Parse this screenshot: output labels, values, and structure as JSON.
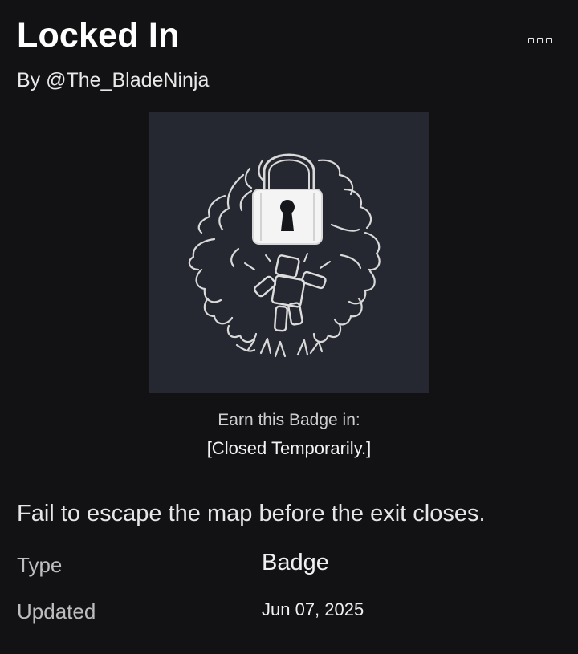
{
  "header": {
    "title": "Locked In",
    "creator": "By @The_BladeNinja",
    "more_icon": "more-options-icon"
  },
  "badge": {
    "image_icon": "padlock-character-icon",
    "image_background": "#252831",
    "earn_label": "Earn this Badge in:",
    "place_name": "[Closed Temporarily.]",
    "description": "Fail to escape the map before the exit closes."
  },
  "details": {
    "type_label": "Type",
    "type_value": "Badge",
    "updated_label": "Updated",
    "updated_value": "Jun 07, 2025"
  },
  "colors": {
    "page_background": "#121215",
    "text_primary": "#ffffff",
    "text_secondary": "#bdbdc0"
  }
}
